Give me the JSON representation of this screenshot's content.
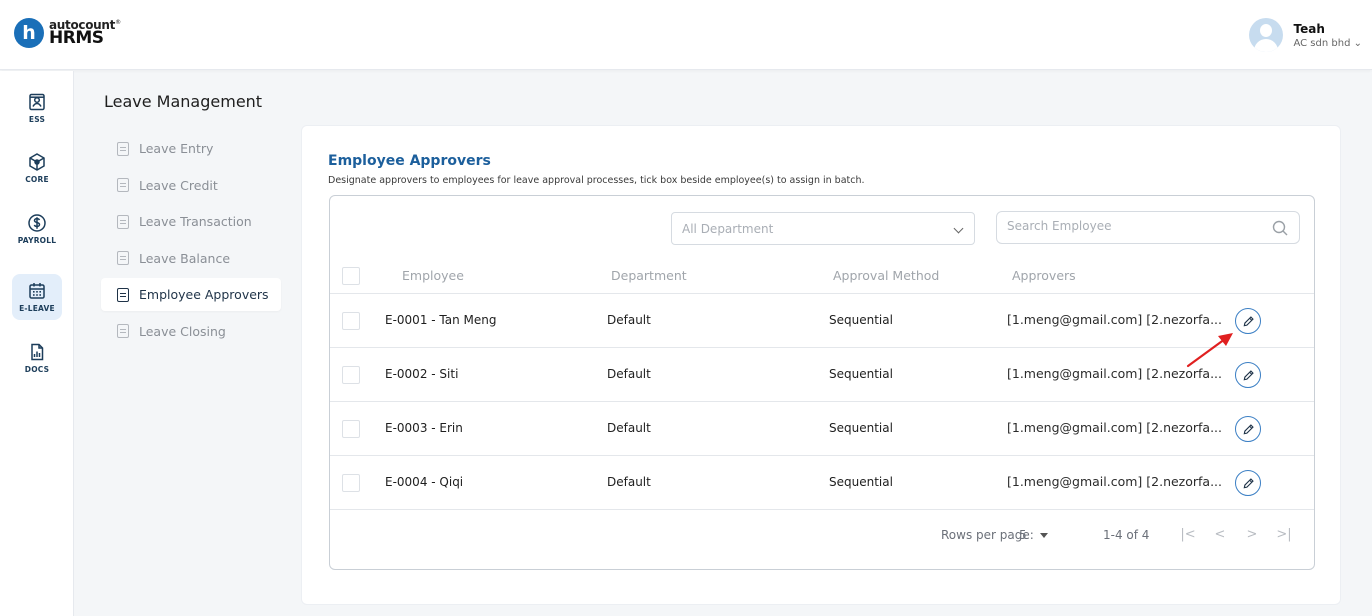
{
  "brand": {
    "top": "autocount",
    "mark": "®",
    "bottom": "HRMS",
    "letter": "h",
    "color": "#1a6fb8"
  },
  "user": {
    "name": "Teah",
    "company": "AC sdn bhd",
    "company_caret": "⌄"
  },
  "rail": [
    {
      "label": "ESS",
      "icon": "id-card-icon"
    },
    {
      "label": "CORE",
      "icon": "cube-icon"
    },
    {
      "label": "PAYROLL",
      "icon": "dollar-icon"
    },
    {
      "label": "E-LEAVE",
      "icon": "calendar-icon",
      "active": true
    },
    {
      "label": "DOCS",
      "icon": "document-chart-icon"
    }
  ],
  "submenu": {
    "title": "Leave Management",
    "items": [
      {
        "label": "Leave Entry"
      },
      {
        "label": "Leave Credit"
      },
      {
        "label": "Leave Transaction"
      },
      {
        "label": "Leave Balance"
      },
      {
        "label": "Employee Approvers",
        "active": true
      },
      {
        "label": "Leave Closing"
      }
    ]
  },
  "panel": {
    "title": "Employee Approvers",
    "description": "Designate approvers to employees for leave approval processes, tick box beside employee(s) to assign in batch."
  },
  "filters": {
    "department": "All Department",
    "search_placeholder": "Search Employee"
  },
  "table": {
    "columns": [
      "Employee",
      "Department",
      "Approval Method",
      "Approvers"
    ],
    "rows": [
      {
        "employee": "E-0001 - Tan Meng",
        "department": "Default",
        "method": "Sequential",
        "approvers": "[1.meng@gmail.com] [2.nezorfa..."
      },
      {
        "employee": "E-0002 - Siti",
        "department": "Default",
        "method": "Sequential",
        "approvers": "[1.meng@gmail.com] [2.nezorfa..."
      },
      {
        "employee": "E-0003 - Erin",
        "department": "Default",
        "method": "Sequential",
        "approvers": "[1.meng@gmail.com] [2.nezorfa..."
      },
      {
        "employee": "E-0004 - Qiqi",
        "department": "Default",
        "method": "Sequential",
        "approvers": "[1.meng@gmail.com] [2.nezorfa..."
      }
    ]
  },
  "pagination": {
    "rows_per_page_label": "Rows per page:",
    "rows_per_page": "5",
    "range": "1-4 of 4",
    "first": "|<",
    "prev": "<",
    "next": ">",
    "last": ">|"
  },
  "colors": {
    "accent": "#1c5f9c",
    "annotation_arrow": "#e02020"
  }
}
